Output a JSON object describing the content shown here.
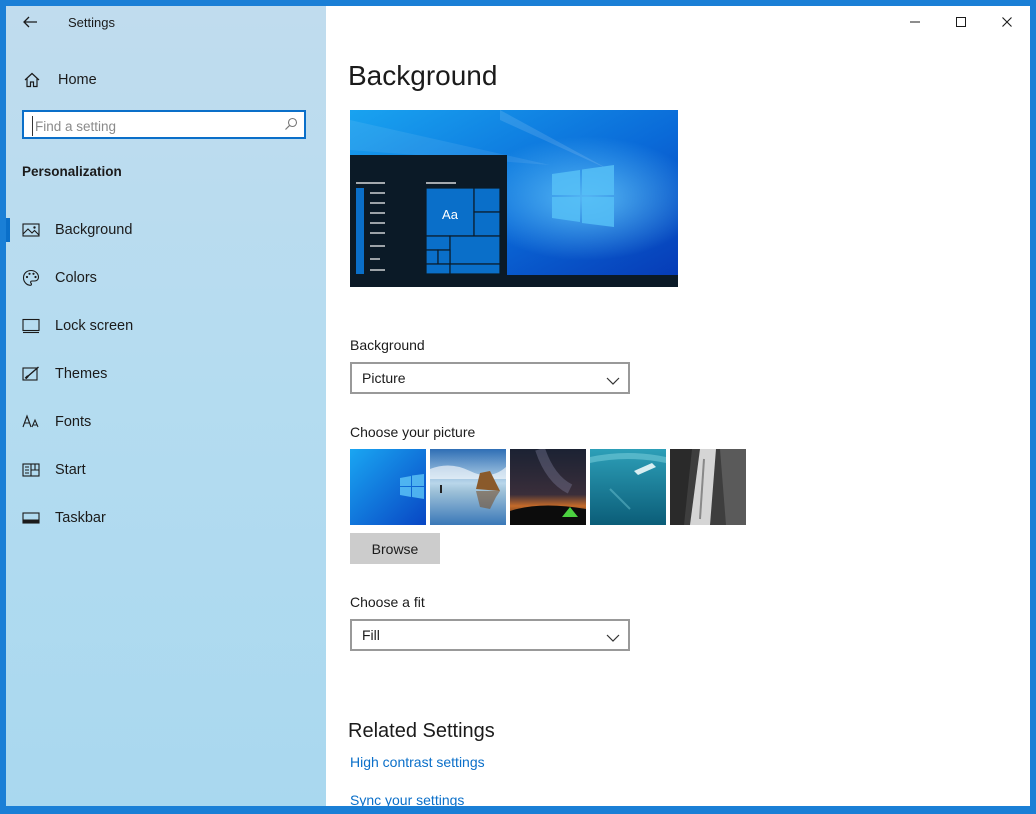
{
  "window": {
    "title": "Settings"
  },
  "nav": {
    "home_label": "Home",
    "search_placeholder": "Find a setting",
    "section": "Personalization",
    "items": [
      {
        "label": "Background",
        "icon": "picture-icon",
        "active": true
      },
      {
        "label": "Colors",
        "icon": "palette-icon",
        "active": false
      },
      {
        "label": "Lock screen",
        "icon": "lock-screen-icon",
        "active": false
      },
      {
        "label": "Themes",
        "icon": "brush-icon",
        "active": false
      },
      {
        "label": "Fonts",
        "icon": "font-icon",
        "active": false
      },
      {
        "label": "Start",
        "icon": "start-icon",
        "active": false
      },
      {
        "label": "Taskbar",
        "icon": "taskbar-icon",
        "active": false
      }
    ]
  },
  "main": {
    "title": "Background",
    "preview": {
      "tile_label": "Aa"
    },
    "background_label": "Background",
    "background_value": "Picture",
    "choose_picture_label": "Choose your picture",
    "thumbnails": [
      "windows-blue",
      "beach-rocks",
      "milky-way-tent",
      "underwater-swimmer",
      "rock-cliff"
    ],
    "browse_label": "Browse",
    "fit_label": "Choose a fit",
    "fit_value": "Fill",
    "related_title": "Related Settings",
    "related_links": [
      "High contrast settings",
      "Sync your settings"
    ]
  },
  "colors": {
    "accent": "#0a6fc9",
    "nav_bg": "#b5dcf0",
    "desktop_border": "#1a7fd6"
  }
}
